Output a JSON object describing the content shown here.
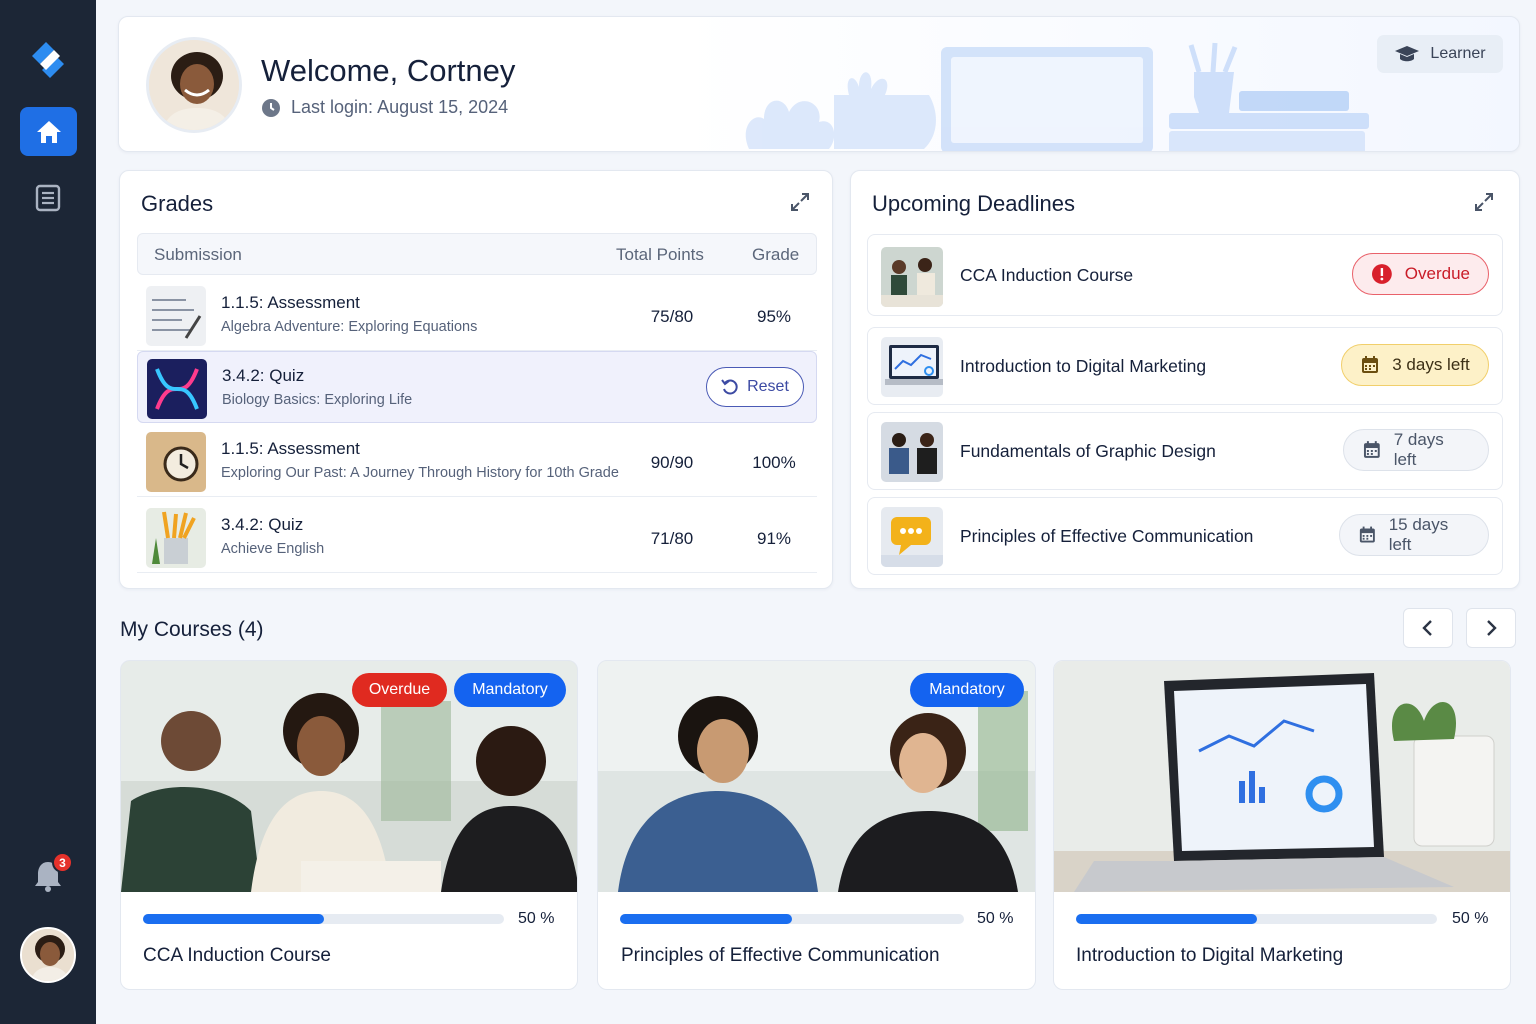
{
  "sidebar": {
    "notifications_count": "3",
    "icons": [
      "logo-icon",
      "home-icon",
      "document-icon",
      "bell-icon",
      "avatar"
    ]
  },
  "welcome": {
    "title": "Welcome, Cortney",
    "last_login": "Last login: August 15, 2024",
    "role_chip": "Learner"
  },
  "grades": {
    "title": "Grades",
    "columns": [
      "Submission",
      "Total Points",
      "Grade"
    ],
    "rows": [
      {
        "title": "1.1.5: Assessment",
        "subtitle": "Algebra Adventure: Exploring Equations",
        "points": "75/80",
        "grade": "95%"
      },
      {
        "title": "3.4.2: Quiz",
        "subtitle": "Biology Basics: Exploring Life",
        "action": "Reset"
      },
      {
        "title": "1.1.5: Assessment",
        "subtitle": "Exploring Our Past: A Journey Through History for 10th Grade",
        "points": "90/90",
        "grade": "100%"
      },
      {
        "title": "3.4.2: Quiz",
        "subtitle": "Achieve English",
        "points": "71/80",
        "grade": "91%"
      }
    ]
  },
  "deadlines": {
    "title": "Upcoming Deadlines",
    "items": [
      {
        "title": "CCA Induction Course",
        "badge": "Overdue",
        "status": "overdue"
      },
      {
        "title": "Introduction to Digital Marketing",
        "badge": "3 days left",
        "status": "warning"
      },
      {
        "title": "Fundamentals of Graphic Design",
        "badge": "7 days left",
        "status": "neutral"
      },
      {
        "title": "Principles of Effective Communication",
        "badge": "15 days left",
        "status": "neutral"
      }
    ]
  },
  "courses": {
    "title": "My Courses (4)",
    "items": [
      {
        "name": "CCA Induction Course",
        "tags": [
          "Overdue",
          "Mandatory"
        ],
        "progress": 50,
        "progress_label": "50 %"
      },
      {
        "name": "Principles of Effective Communication",
        "tags": [
          "Mandatory"
        ],
        "progress": 50,
        "progress_label": "50 %"
      },
      {
        "name": "Introduction to Digital Marketing",
        "tags": [],
        "progress": 50,
        "progress_label": "50 %"
      }
    ]
  },
  "colors": {
    "sidebar": "#1c2636",
    "accent": "#1f6fe5",
    "overdue": "#e02a20",
    "mandatory": "#1463f0",
    "warning_bg": "#fdf1c8"
  }
}
